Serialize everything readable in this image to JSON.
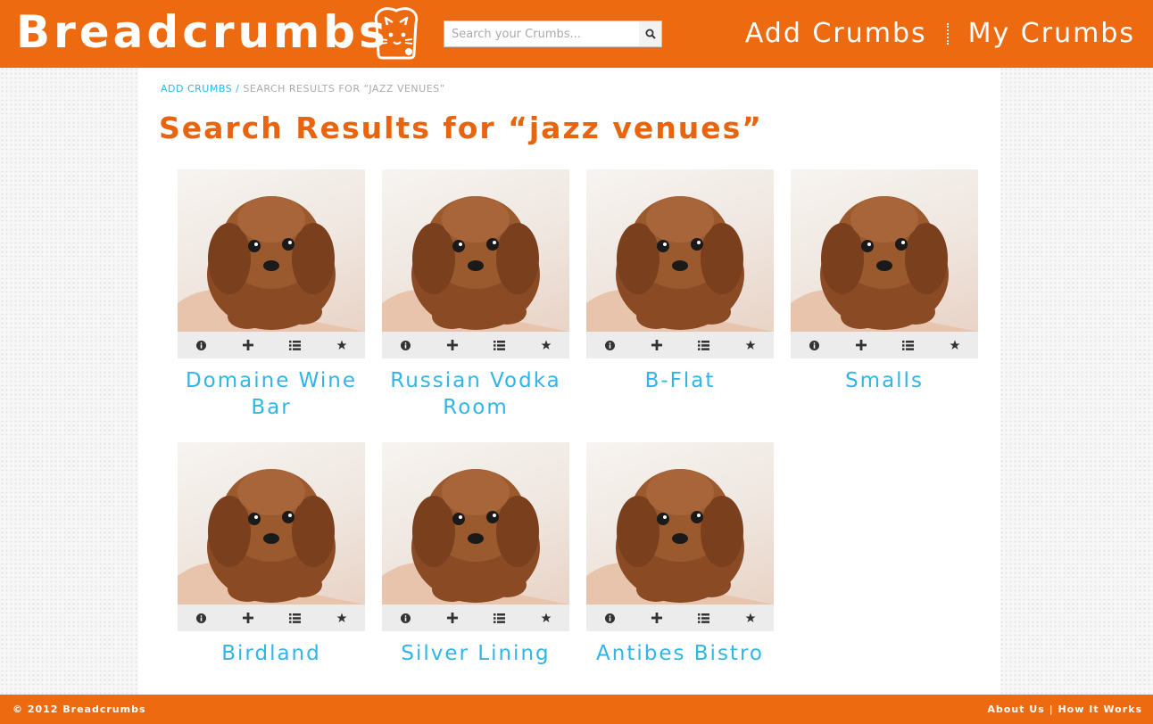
{
  "header": {
    "logo_text": "Breadcrumbs",
    "logo_icon": "toast-cat-icon",
    "search": {
      "placeholder": "Search your Crumbs...",
      "value": ""
    },
    "nav": [
      {
        "label": "Add Crumbs"
      },
      {
        "label": "My Crumbs"
      }
    ]
  },
  "breadcrumb": {
    "link_label": "ADD CRUMBS",
    "separator": "/",
    "current": "SEARCH RESULTS FOR “JAZZ VENUES”"
  },
  "page_title": "Search Results for “jazz venues”",
  "card_actions": [
    "info-icon",
    "plus-icon",
    "list-icon",
    "star-icon"
  ],
  "results": [
    {
      "title": "Domaine Wine Bar",
      "image": "puppy-photo"
    },
    {
      "title": "Russian Vodka Room",
      "image": "puppy-photo"
    },
    {
      "title": "B-Flat",
      "image": "puppy-photo"
    },
    {
      "title": "Smalls",
      "image": "puppy-photo"
    },
    {
      "title": "Birdland",
      "image": "puppy-photo"
    },
    {
      "title": "Silver Lining",
      "image": "puppy-photo"
    },
    {
      "title": "Antibes Bistro",
      "image": "puppy-photo"
    }
  ],
  "footer": {
    "copyright": "© 2012 Breadcrumbs",
    "links": [
      {
        "label": "About Us"
      },
      {
        "label": "How It Works"
      }
    ],
    "separator": "|"
  },
  "colors": {
    "brand_orange": "#ee6a10",
    "title_orange": "#e8640f",
    "link_blue": "#30b5e8"
  }
}
